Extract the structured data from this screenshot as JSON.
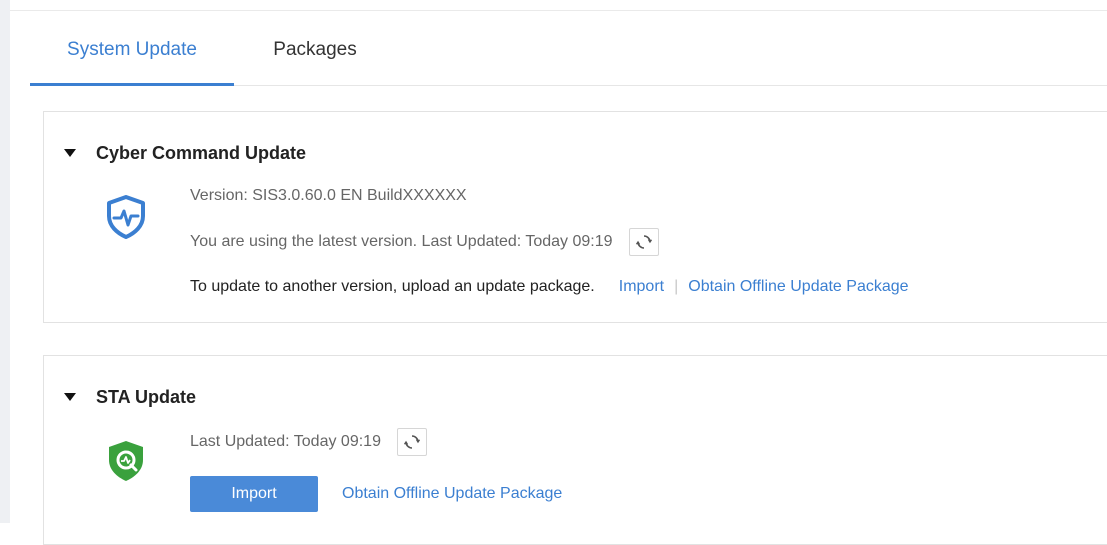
{
  "tabs": [
    {
      "label": "System Update",
      "active": true
    },
    {
      "label": "Packages",
      "active": false
    }
  ],
  "cyber": {
    "title": "Cyber Command Update",
    "icon": "shield-pulse-icon",
    "version": "Version: SIS3.0.60.0 EN BuildXXXXXX",
    "status": "You are using the latest version. Last Updated: Today 09:19",
    "instruction": "To update to another version, upload an update package.",
    "import_link": "Import",
    "separator": "|",
    "offline_link": "Obtain Offline Update Package"
  },
  "sta": {
    "title": "STA Update",
    "icon": "shield-search-icon",
    "status": "Last Updated: Today 09:19",
    "import_button": "Import",
    "offline_link": "Obtain Offline Update Package"
  },
  "colors": {
    "accent": "#3b7fd1",
    "button": "#4a8ad8",
    "sta_green": "#3aa13d"
  }
}
